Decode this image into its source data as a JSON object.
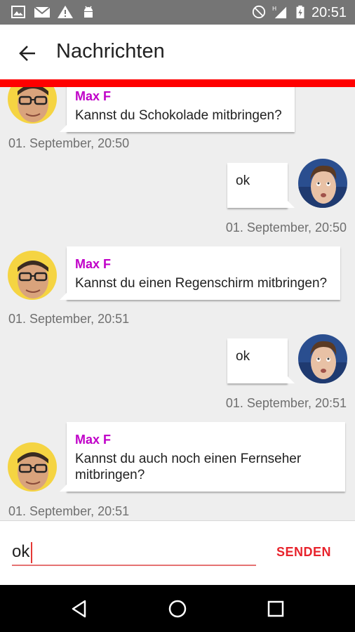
{
  "status_bar": {
    "time": "20:51",
    "icons": [
      "image-icon",
      "gmail-icon",
      "warning-icon",
      "android-icon",
      "do-not-disturb-icon",
      "signal-h-icon",
      "battery-charging-icon"
    ]
  },
  "toolbar": {
    "title": "Nachrichten"
  },
  "colors": {
    "accent": "#ff0000",
    "sender": "#c000c8",
    "send": "#e8232c"
  },
  "messages": [
    {
      "direction": "incoming",
      "sender": "Max F",
      "text": "Kannst du Schokolade mitbringen?",
      "time": "01. September, 20:50"
    },
    {
      "direction": "outgoing",
      "text": "ok",
      "time": "01. September, 20:50"
    },
    {
      "direction": "incoming",
      "sender": "Max F",
      "text": "Kannst du einen Regenschirm mitbringen?",
      "time": "01. September, 20:51"
    },
    {
      "direction": "outgoing",
      "text": "ok",
      "time": "01. September, 20:51"
    },
    {
      "direction": "incoming",
      "sender": "Max F",
      "text": "Kannst du auch noch einen Fernseher mitbringen?",
      "time": "01. September, 20:51"
    }
  ],
  "compose": {
    "value": "ok",
    "send_label": "SENDEN"
  }
}
